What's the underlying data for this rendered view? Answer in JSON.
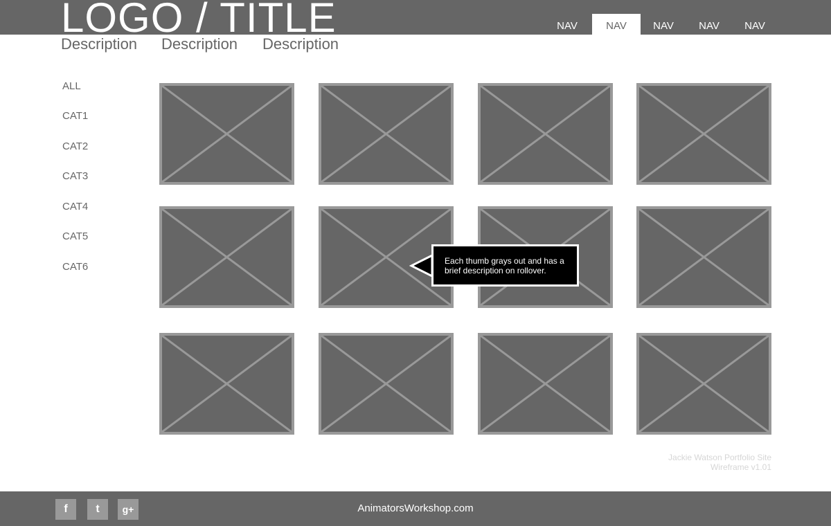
{
  "header": {
    "logo_text": "LOGO / TITLE",
    "descriptions": [
      "Description",
      "Description",
      "Description"
    ],
    "nav": [
      {
        "label": "NAV",
        "active": false
      },
      {
        "label": "NAV",
        "active": true
      },
      {
        "label": "NAV",
        "active": false
      },
      {
        "label": "NAV",
        "active": false
      },
      {
        "label": "NAV",
        "active": false
      }
    ]
  },
  "sidebar": {
    "categories": [
      "ALL",
      "CAT1",
      "CAT2",
      "CAT3",
      "CAT4",
      "CAT5",
      "CAT6"
    ]
  },
  "gallery": {
    "rows": 3,
    "columns": 4,
    "tooltip": "Each thumb grays out and has a brief description on rollover."
  },
  "credit": {
    "line1": "Jackie Watson Portfolio Site",
    "line2": "Wireframe v1.01"
  },
  "footer": {
    "social": [
      {
        "icon": "facebook-icon",
        "glyph": "f"
      },
      {
        "icon": "twitter-icon",
        "glyph": "t"
      },
      {
        "icon": "google-plus-icon",
        "glyph": "g+"
      }
    ],
    "site_link": "AnimatorsWorkshop.com"
  },
  "colors": {
    "band": "#666666",
    "thumb_border": "#999999",
    "tooltip_bg": "#000000",
    "credit_text": "#d6d6d6"
  }
}
